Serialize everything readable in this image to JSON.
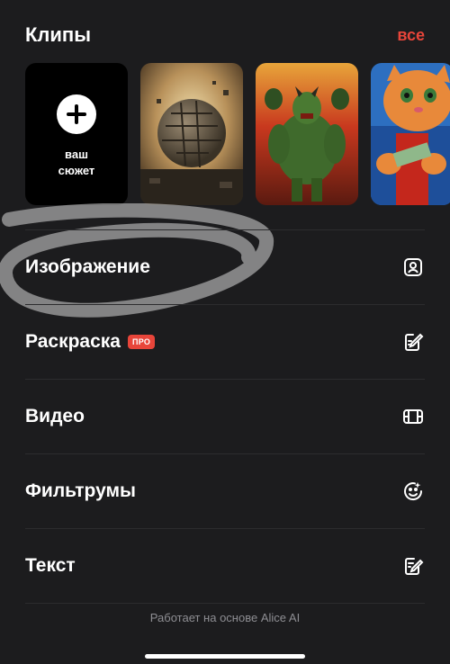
{
  "clips": {
    "title": "Клипы",
    "all_label": "все",
    "new_clip_label": "ваш сюжет",
    "thumbnails": [
      {
        "name": "clip-rock-ball"
      },
      {
        "name": "clip-green-monster"
      },
      {
        "name": "clip-cat-money"
      }
    ]
  },
  "menu": {
    "items": [
      {
        "label": "Изображение",
        "icon": "image-icon"
      },
      {
        "label": "Раскраска",
        "badge": "ПРО",
        "icon": "edit-pencil-icon"
      },
      {
        "label": "Видео",
        "icon": "film-icon"
      },
      {
        "label": "Фильтрумы",
        "icon": "face-filter-icon"
      },
      {
        "label": "Текст",
        "icon": "text-edit-icon"
      }
    ]
  },
  "footer": {
    "powered_by": "Работает на основе Alice AI"
  },
  "colors": {
    "background": "#1c1c1e",
    "accent": "#e8453a",
    "muted": "#8e8e93"
  }
}
